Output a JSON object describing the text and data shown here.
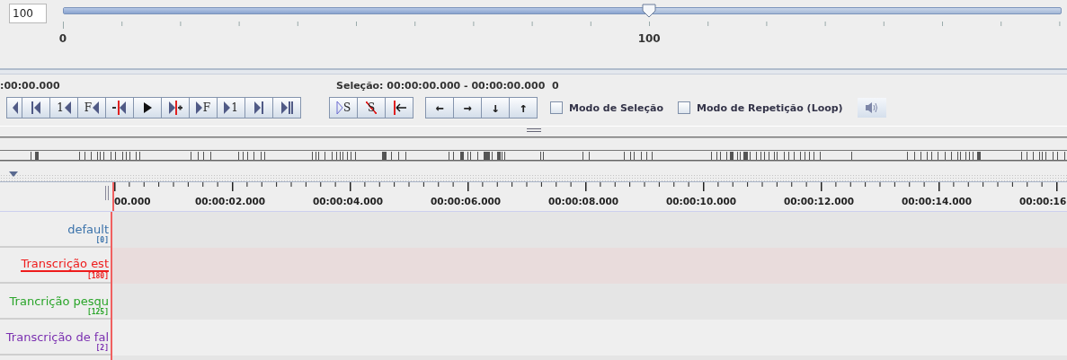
{
  "zoom": {
    "value": "100",
    "level": 0.587,
    "ruler_labels": [
      "0",
      "100"
    ]
  },
  "time": ":00:00.000",
  "selection": "Seleção: 00:00:00.000 - 00:00:00.000  0",
  "media_buttons": [
    {
      "kind": "prev-cut"
    },
    {
      "kind": "bar-prev"
    },
    {
      "kind": "label-prev",
      "label": "1"
    },
    {
      "kind": "label-prev",
      "label": "F"
    },
    {
      "kind": "cursor-prev"
    },
    {
      "kind": "play"
    },
    {
      "kind": "cursor-next"
    },
    {
      "kind": "label-next",
      "label": "F"
    },
    {
      "kind": "label-next",
      "label": "1"
    },
    {
      "kind": "bar-next"
    },
    {
      "kind": "pause-next"
    }
  ],
  "selection_buttons": [
    {
      "kind": "play-selection",
      "label": "S"
    },
    {
      "kind": "clear-selection",
      "label": "S"
    },
    {
      "kind": "to-begin"
    }
  ],
  "arrow_buttons": [
    "←",
    "→",
    "↓",
    "↑"
  ],
  "checkboxes": [
    {
      "label": "Modo de Seleção",
      "checked": false
    },
    {
      "label": "Modo de Repetição (Loop)",
      "checked": false
    }
  ],
  "timeline": {
    "labels": [
      "00.000",
      "00:00:02.000",
      "00:00:04.000",
      "00:00:06.000",
      "00:00:08.000",
      "00:00:10.000",
      "00:00:12.000",
      "00:00:14.000",
      "00:00:16"
    ]
  },
  "tiers": [
    {
      "name": "default",
      "count": "[0]",
      "color": "#3a72aa",
      "selected": false
    },
    {
      "name": "Transcrição est",
      "count": "[180]",
      "color": "#ee1c1c",
      "selected": true
    },
    {
      "name": "Trancrição pesqu",
      "count": "[125]",
      "color": "#2aa52a",
      "selected": false
    },
    {
      "name": "Transcrição de fal",
      "count": "[2]",
      "color": "#7a2fb0",
      "selected": false
    }
  ]
}
